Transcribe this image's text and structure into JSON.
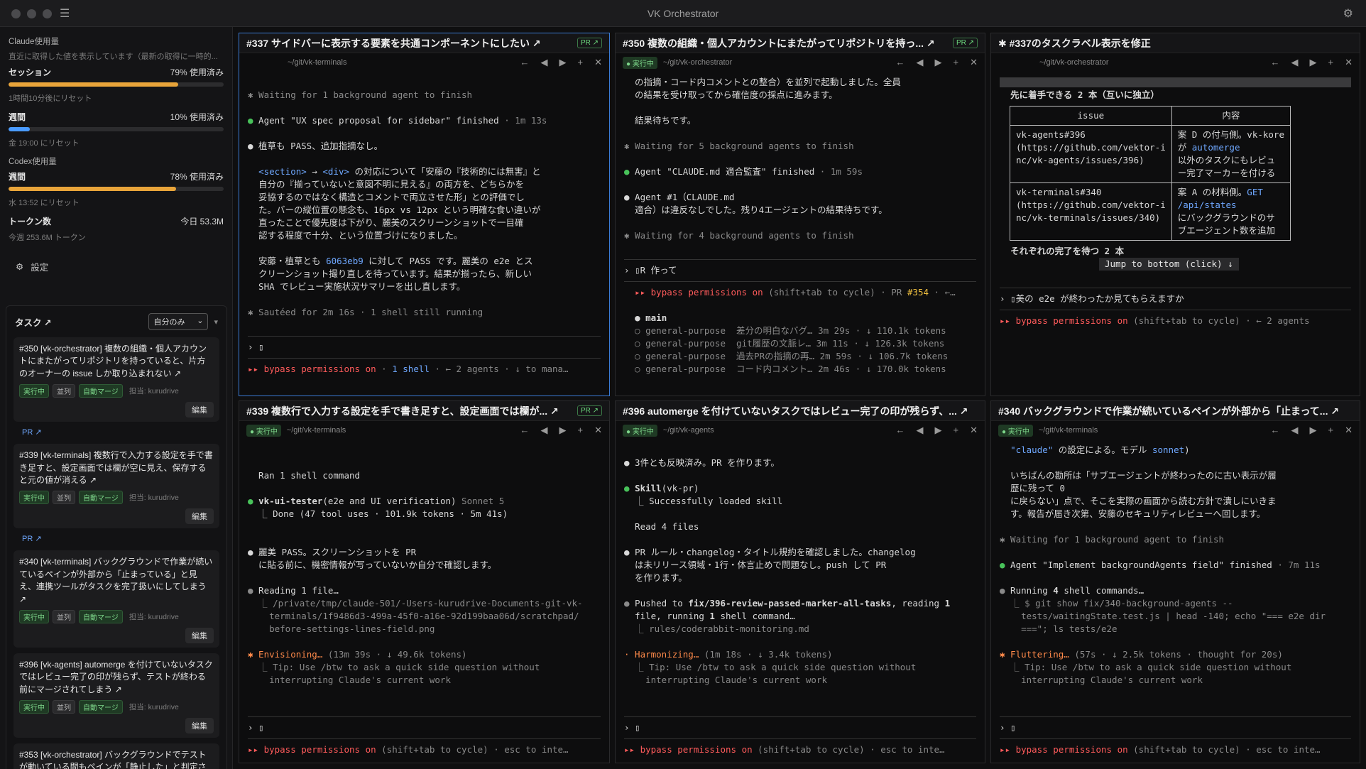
{
  "app": {
    "title": "VK Orchestrator"
  },
  "sidebar": {
    "claude": {
      "heading": "Claude使用量",
      "note": "直近に取得した値を表示しています（最新の取得に一時的...",
      "session": {
        "label": "セッション",
        "value": "79% 使用済み",
        "pct": 79,
        "reset": "1時間10分後にリセット"
      },
      "week": {
        "label": "週間",
        "value": "10% 使用済み",
        "pct": 10,
        "reset": "金 19:00 にリセット"
      }
    },
    "codex": {
      "heading": "Codex使用量",
      "week": {
        "label": "週間",
        "value": "78% 使用済み",
        "pct": 78,
        "reset": "水 13:52 にリセット"
      }
    },
    "tokens": {
      "label": "トークン数",
      "value": "今日 53.3M",
      "sub": "今週 253.6M トークン"
    },
    "settings": "設定",
    "tasks": {
      "heading": "タスク ↗",
      "filter": "自分のみ",
      "items": [
        {
          "title": "#350 [vk-orchestrator] 複数の組織・個人アカウントにまたがってリポジトリを持っていると、片方のオーナーの issue しか取り込まれない ↗",
          "pr": "PR ↗"
        },
        {
          "title": "#339 [vk-terminals] 複数行で入力する設定を手で書き足すと、設定画面では欄が空に見え、保存すると元の値が消える ↗",
          "pr": "PR ↗"
        },
        {
          "title": "#340 [vk-terminals] バックグラウンドで作業が続いているペインが外部から「止まっている」と見え、連携ツールがタスクを完了扱いにしてしまう ↗",
          "pr": ""
        },
        {
          "title": "#396 [vk-agents] automerge を付けていないタスクではレビュー完了の印が残らず、テストが終わる前にマージされてしまう ↗",
          "pr": ""
        },
        {
          "title": "#353 [vk-orchestrator] バックグラウンドでテストが動いている間もペインが「静止した」と判定さ",
          "pr": ""
        }
      ],
      "tag_running": "実行中",
      "tag_parallel": "並列",
      "tag_automerge": "自動マージ",
      "assignee": "担当: kurudrive",
      "edit": "編集"
    }
  },
  "panes": {
    "p1": {
      "title": "#337 サイドバーに表示する要素を共通コンポーネントにしたい ↗",
      "pr": "PR ↗",
      "path": "~/git/vk-terminals"
    },
    "p2": {
      "title": "#350 複数の組織・個人アカウントにまたがってリポジトリを持っ... ↗",
      "pr": "PR ↗",
      "status": "● 実行中",
      "path": "~/git/vk-orchestrator"
    },
    "p3": {
      "title": "✱ #337のタスクラベル表示を修正",
      "path": "~/git/vk-orchestrator"
    },
    "p4": {
      "title": "#339 複数行で入力する設定を手で書き足すと、設定画面では欄が... ↗",
      "pr": "PR ↗",
      "status": "● 実行中",
      "path": "~/git/vk-terminals"
    },
    "p5": {
      "title": "#396 automerge を付けていないタスクではレビュー完了の印が残らず、... ↗",
      "status": "● 実行中",
      "path": "~/git/vk-agents"
    },
    "p6": {
      "title": "#340 バックグラウンドで作業が続いているペインが外部から「止まって... ↗",
      "status": "● 実行中",
      "path": "~/git/vk-terminals"
    }
  },
  "colors": {
    "accent": "#3a7bd5",
    "session_bar": "#e8a43a",
    "week_bar": "#4a9bff",
    "codex_bar": "#e8a43a"
  }
}
